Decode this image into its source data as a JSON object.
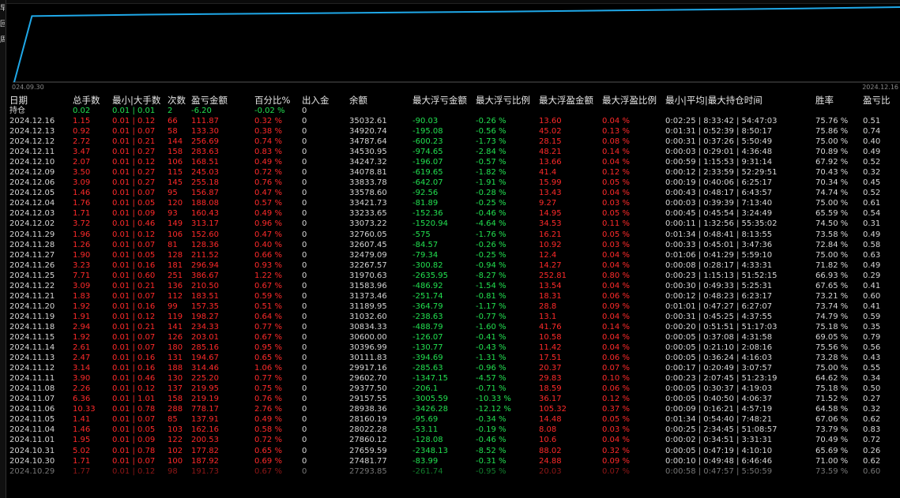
{
  "chart": {
    "date_start": "024.09.30",
    "date_end": "2024.12.16",
    "line_color": "#1fa8e8",
    "curve": [
      0.0,
      0.88,
      0.9,
      0.92,
      0.94,
      0.96,
      0.98,
      1.0
    ]
  },
  "left_labels": [
    "早",
    "回",
    "周"
  ],
  "table": {
    "headers": {
      "date": "日期",
      "lots": "总手数",
      "minmax": "最小|大手数",
      "count": "次数",
      "pnl": "盈亏金额",
      "pct": "百分比%",
      "deposit": "出入金",
      "balance": "余额",
      "max_float_loss": "最大浮亏金额",
      "max_float_loss_pct": "最大浮亏比例",
      "max_float_profit": "最大浮盈金额",
      "max_float_profit_pct": "最大浮盈比例",
      "hold_time": "最小|平均|最大持仓时间",
      "win_rate": "胜率",
      "pl_ratio": "盈亏比"
    },
    "position": {
      "label": "持仓",
      "lots": "0.02",
      "minmax": "0.01 | 0.01",
      "count": "2",
      "pnl": "-6.20",
      "pct": "-0.02 %",
      "deposit": "0"
    },
    "rows": [
      [
        "2024.12.16",
        "1.15",
        "0.01 | 0.12",
        "66",
        "111.87",
        "0.32 %",
        "0",
        "35032.61",
        "-90.03",
        "-0.26 %",
        "13.60",
        "0.04 %",
        "0:02:25 | 8:33:42 | 54:47:03",
        "75.76 %",
        "0.51"
      ],
      [
        "2024.12.13",
        "0.92",
        "0.01 | 0.07",
        "58",
        "133.30",
        "0.38 %",
        "0",
        "34920.74",
        "-195.08",
        "-0.56 %",
        "45.02",
        "0.13 %",
        "0:01:31 | 0:52:39 | 8:50:17",
        "75.86 %",
        "0.74"
      ],
      [
        "2024.12.12",
        "2.72",
        "0.01 | 0.21",
        "144",
        "256.69",
        "0.74 %",
        "0",
        "34787.64",
        "-600.23",
        "-1.73 %",
        "28.15",
        "0.08 %",
        "0:00:31 | 0:37:26 | 5:50:49",
        "75.00 %",
        "0.40"
      ],
      [
        "2024.12.11",
        "3.47",
        "0.01 | 0.27",
        "158",
        "283.63",
        "0.83 %",
        "0",
        "34530.95",
        "-974.65",
        "-2.84 %",
        "48.21",
        "0.14 %",
        "0:00:03 | 0:29:01 | 4:36:48",
        "70.89 %",
        "0.49"
      ],
      [
        "2024.12.10",
        "2.07",
        "0.01 | 0.12",
        "106",
        "168.51",
        "0.49 %",
        "0",
        "34247.32",
        "-196.07",
        "-0.57 %",
        "13.66",
        "0.04 %",
        "0:00:59 | 1:15:53 | 9:31:14",
        "67.92 %",
        "0.52"
      ],
      [
        "2024.12.09",
        "3.50",
        "0.01 | 0.27",
        "115",
        "245.03",
        "0.72 %",
        "0",
        "34078.81",
        "-619.65",
        "-1.82 %",
        "41.4",
        "0.12 %",
        "0:00:12 | 2:33:59 | 52:29:51",
        "70.43 %",
        "0.32"
      ],
      [
        "2024.12.06",
        "3.09",
        "0.01 | 0.27",
        "145",
        "255.18",
        "0.76 %",
        "0",
        "33833.78",
        "-642.07",
        "-1.91 %",
        "15.99",
        "0.05 %",
        "0:00:19 | 0:40:06 | 6:25:17",
        "70.34 %",
        "0.45"
      ],
      [
        "2024.12.05",
        "1.46",
        "0.01 | 0.07",
        "95",
        "156.87",
        "0.47 %",
        "0",
        "33578.60",
        "-92.56",
        "-0.28 %",
        "13.43",
        "0.04 %",
        "0:00:43 | 0:48:17 | 6:43:57",
        "74.74 %",
        "0.52"
      ],
      [
        "2024.12.04",
        "1.76",
        "0.01 | 0.05",
        "120",
        "188.08",
        "0.57 %",
        "0",
        "33421.73",
        "-81.89",
        "-0.25 %",
        "9.27",
        "0.03 %",
        "0:00:03 | 0:39:39 | 7:13:40",
        "75.00 %",
        "0.61"
      ],
      [
        "2024.12.03",
        "1.71",
        "0.01 | 0.09",
        "93",
        "160.43",
        "0.49 %",
        "0",
        "33233.65",
        "-152.36",
        "-0.46 %",
        "14.95",
        "0.05 %",
        "0:00:45 | 0:45:54 | 3:24:49",
        "65.59 %",
        "0.54"
      ],
      [
        "2024.12.02",
        "3.72",
        "0.01 | 0.46",
        "149",
        "313.17",
        "0.96 %",
        "0",
        "33073.22",
        "-1520.94",
        "-4.64 %",
        "34.53",
        "0.11 %",
        "0:00:11 | 1:32:56 | 55:35:02",
        "74.50 %",
        "0.31"
      ],
      [
        "2024.11.29",
        "1.96",
        "0.01 | 0.12",
        "106",
        "152.60",
        "0.47 %",
        "0",
        "32760.05",
        "-575",
        "-1.76 %",
        "16.21",
        "0.05 %",
        "0:01:34 | 0:48:41 | 8:13:55",
        "73.58 %",
        "0.49"
      ],
      [
        "2024.11.28",
        "1.26",
        "0.01 | 0.07",
        "81",
        "128.36",
        "0.40 %",
        "0",
        "32607.45",
        "-84.57",
        "-0.26 %",
        "10.92",
        "0.03 %",
        "0:00:33 | 0:45:01 | 3:47:36",
        "72.84 %",
        "0.58"
      ],
      [
        "2024.11.27",
        "1.90",
        "0.01 | 0.05",
        "128",
        "211.52",
        "0.66 %",
        "0",
        "32479.09",
        "-79.34",
        "-0.25 %",
        "12.4",
        "0.04 %",
        "0:01:06 | 0:41:29 | 5:59:10",
        "75.00 %",
        "0.63"
      ],
      [
        "2024.11.26",
        "3.23",
        "0.01 | 0.16",
        "181",
        "296.94",
        "0.93 %",
        "0",
        "32267.57",
        "-300.82",
        "-0.94 %",
        "14.27",
        "0.04 %",
        "0:00:08 | 0:28:17 | 4:33:31",
        "71.82 %",
        "0.49"
      ],
      [
        "2024.11.25",
        "7.71",
        "0.01 | 0.60",
        "251",
        "386.67",
        "1.22 %",
        "0",
        "31970.63",
        "-2635.95",
        "-8.27 %",
        "252.81",
        "0.80 %",
        "0:00:23 | 1:15:13 | 51:52:15",
        "66.93 %",
        "0.29"
      ],
      [
        "2024.11.22",
        "3.09",
        "0.01 | 0.21",
        "136",
        "210.50",
        "0.67 %",
        "0",
        "31583.96",
        "-486.92",
        "-1.54 %",
        "13.54",
        "0.04 %",
        "0:00:30 | 0:49:33 | 5:25:31",
        "67.65 %",
        "0.41"
      ],
      [
        "2024.11.21",
        "1.83",
        "0.01 | 0.07",
        "112",
        "183.51",
        "0.59 %",
        "0",
        "31373.46",
        "-251.74",
        "-0.81 %",
        "18.31",
        "0.06 %",
        "0:00:12 | 0:48:23 | 6:23:17",
        "73.21 %",
        "0.60"
      ],
      [
        "2024.11.20",
        "1.92",
        "0.01 | 0.16",
        "99",
        "157.35",
        "0.51 %",
        "0",
        "31189.95",
        "-364.79",
        "-1.17 %",
        "28.8",
        "0.09 %",
        "0:01:01 | 0:47:27 | 6:27:07",
        "73.74 %",
        "0.41"
      ],
      [
        "2024.11.19",
        "1.91",
        "0.01 | 0.12",
        "119",
        "198.27",
        "0.64 %",
        "0",
        "31032.60",
        "-238.63",
        "-0.77 %",
        "13.1",
        "0.04 %",
        "0:00:31 | 0:45:25 | 4:37:55",
        "74.79 %",
        "0.59"
      ],
      [
        "2024.11.18",
        "2.94",
        "0.01 | 0.21",
        "141",
        "234.33",
        "0.77 %",
        "0",
        "30834.33",
        "-488.79",
        "-1.60 %",
        "41.76",
        "0.14 %",
        "0:00:20 | 0:51:51 | 51:17:03",
        "75.18 %",
        "0.35"
      ],
      [
        "2024.11.15",
        "1.92",
        "0.01 | 0.07",
        "126",
        "203.01",
        "0.67 %",
        "0",
        "30600.00",
        "-126.07",
        "-0.41 %",
        "10.58",
        "0.04 %",
        "0:00:05 | 0:37:08 | 4:31:58",
        "69.05 %",
        "0.79"
      ],
      [
        "2024.11.14",
        "2.61",
        "0.01 | 0.07",
        "180",
        "285.16",
        "0.95 %",
        "0",
        "30396.99",
        "-130.77",
        "-0.43 %",
        "11.42",
        "0.04 %",
        "0:00:05 | 0:21:10 | 2:08:16",
        "75.56 %",
        "0.56"
      ],
      [
        "2024.11.13",
        "2.47",
        "0.01 | 0.16",
        "131",
        "194.67",
        "0.65 %",
        "0",
        "30111.83",
        "-394.69",
        "-1.31 %",
        "17.51",
        "0.06 %",
        "0:00:05 | 0:36:24 | 4:16:03",
        "73.28 %",
        "0.43"
      ],
      [
        "2024.11.12",
        "3.14",
        "0.01 | 0.16",
        "188",
        "314.46",
        "1.06 %",
        "0",
        "29917.16",
        "-285.63",
        "-0.96 %",
        "20.37",
        "0.07 %",
        "0:00:17 | 0:20:49 | 3:07:57",
        "75.00 %",
        "0.55"
      ],
      [
        "2024.11.11",
        "3.90",
        "0.01 | 0.46",
        "130",
        "225.20",
        "0.77 %",
        "0",
        "29602.70",
        "-1347.15",
        "-4.57 %",
        "29.83",
        "0.10 %",
        "0:00:23 | 2:07:45 | 51:23:19",
        "64.62 %",
        "0.34"
      ],
      [
        "2024.11.08",
        "2.26",
        "0.01 | 0.12",
        "137",
        "219.95",
        "0.75 %",
        "0",
        "29377.50",
        "-206.1",
        "-0.71 %",
        "18.59",
        "0.06 %",
        "0:00:05 | 0:30:37 | 4:19:03",
        "75.18 %",
        "0.50"
      ],
      [
        "2024.11.07",
        "6.36",
        "0.01 | 1.01",
        "158",
        "219.19",
        "0.76 %",
        "0",
        "29157.55",
        "-3005.59",
        "-10.33 %",
        "36.17",
        "0.12 %",
        "0:00:05 | 0:40:50 | 4:06:37",
        "71.52 %",
        "0.27"
      ],
      [
        "2024.11.06",
        "10.33",
        "0.01 | 0.78",
        "288",
        "778.17",
        "2.76 %",
        "0",
        "28938.36",
        "-3426.28",
        "-12.12 %",
        "105.32",
        "0.37 %",
        "0:00:09 | 0:16:21 | 4:57:19",
        "64.58 %",
        "0.32"
      ],
      [
        "2024.11.05",
        "1.41",
        "0.01 | 0.07",
        "85",
        "137.91",
        "0.49 %",
        "0",
        "28160.19",
        "-95.69",
        "-0.34 %",
        "14.48",
        "0.05 %",
        "0:01:34 | 0:54:40 | 7:48:21",
        "67.06 %",
        "0.62"
      ],
      [
        "2024.11.04",
        "1.46",
        "0.01 | 0.05",
        "103",
        "162.16",
        "0.58 %",
        "0",
        "28022.28",
        "-53.11",
        "-0.19 %",
        "8.08",
        "0.03 %",
        "0:00:25 | 2:34:45 | 51:08:57",
        "73.79 %",
        "0.83"
      ],
      [
        "2024.11.01",
        "1.95",
        "0.01 | 0.09",
        "122",
        "200.53",
        "0.72 %",
        "0",
        "27860.12",
        "-128.08",
        "-0.46 %",
        "10.6",
        "0.04 %",
        "0:00:02 | 0:34:51 | 3:31:31",
        "70.49 %",
        "0.72"
      ],
      [
        "2024.10.31",
        "5.02",
        "0.01 | 0.78",
        "102",
        "177.82",
        "0.65 %",
        "0",
        "27659.59",
        "-2348.13",
        "-8.52 %",
        "88.02",
        "0.32 %",
        "0:00:05 | 0:47:19 | 4:10:10",
        "65.69 %",
        "0.26"
      ],
      [
        "2024.10.30",
        "1.71",
        "0.01 | 0.07",
        "100",
        "187.92",
        "0.69 %",
        "0",
        "27481.77",
        "-83.99",
        "-0.31 %",
        "24.88",
        "0.09 %",
        "0:00:10 | 0:49:48 | 6:46:46",
        "71.00 %",
        "0.62"
      ],
      [
        "2024.10.29",
        "1.77",
        "0.01 | 0.12",
        "98",
        "191.73",
        "0.67 %",
        "0",
        "27293.85",
        "-261.74",
        "-0.95 %",
        "20.03",
        "0.07 %",
        "0:00:58 | 0:47:57 | 5:50:59",
        "73.59 %",
        "0.60"
      ]
    ]
  }
}
